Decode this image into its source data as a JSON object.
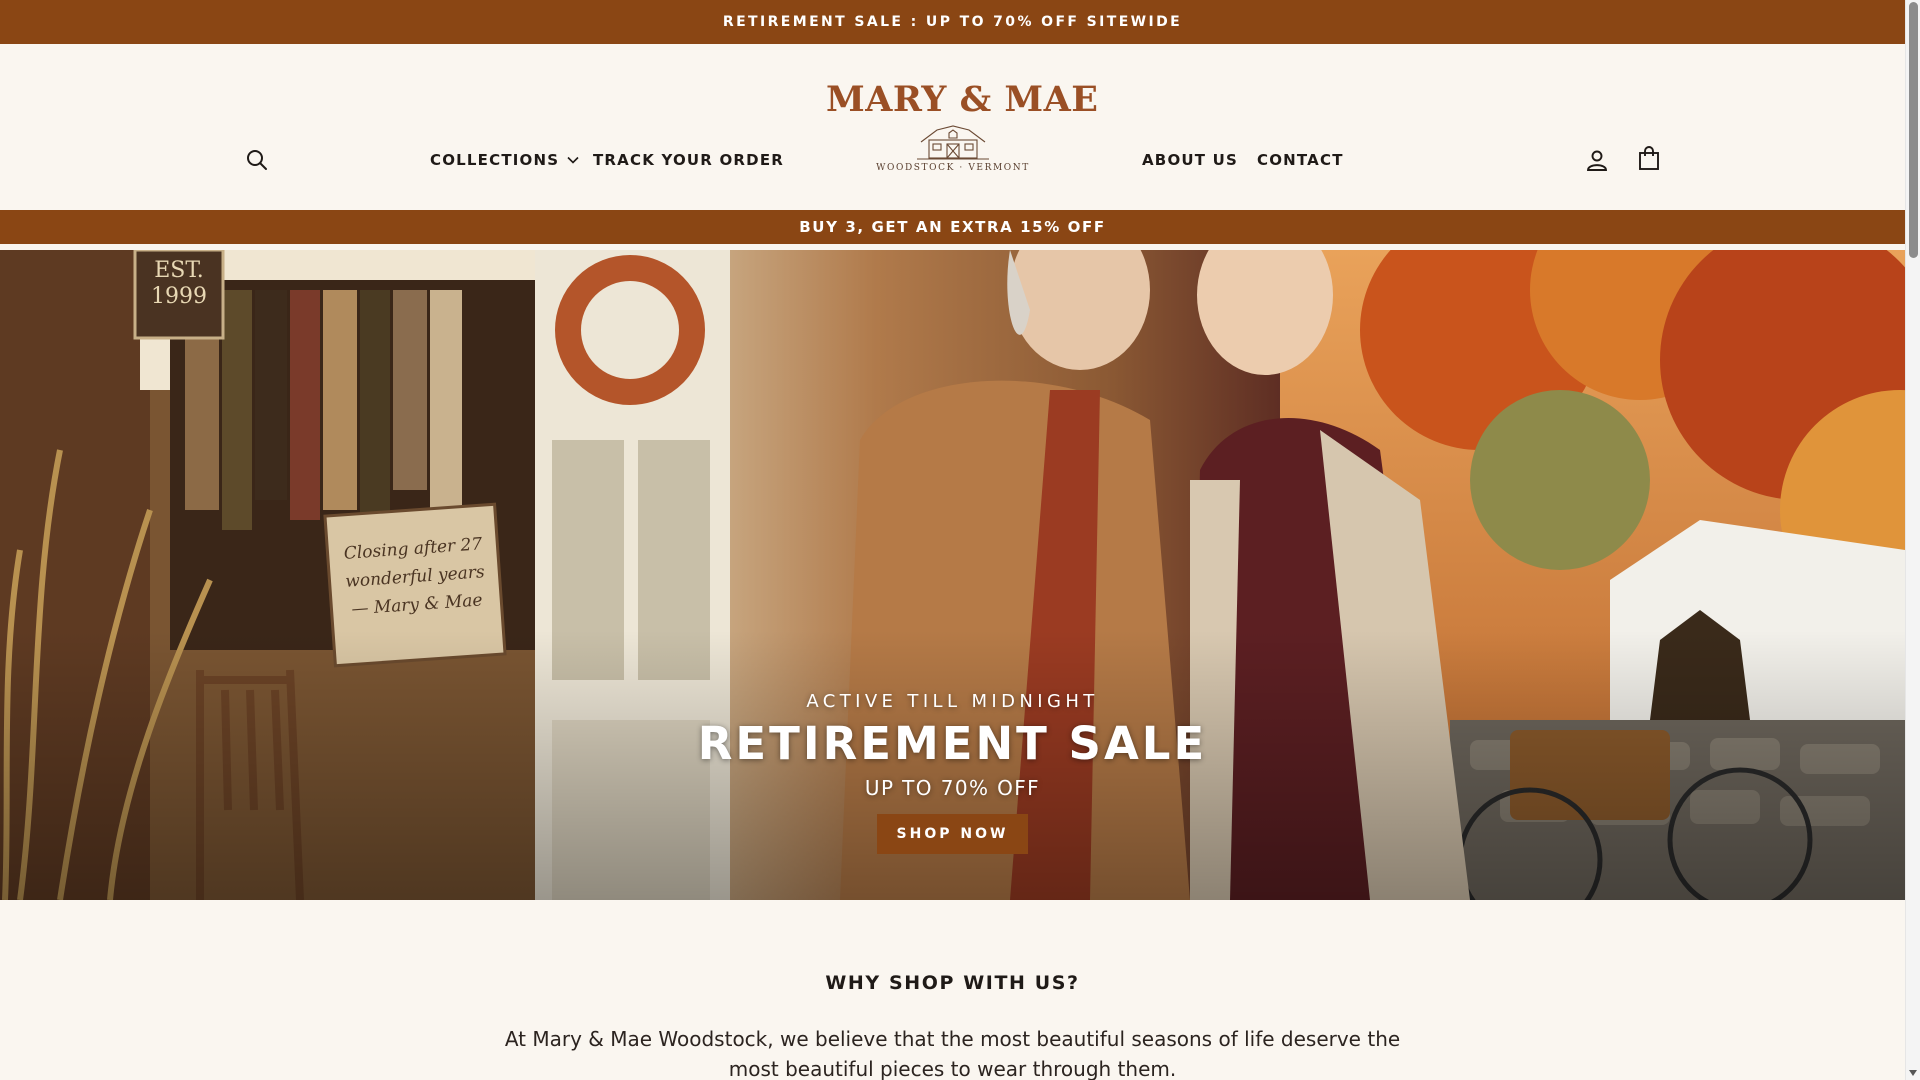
{
  "announcement_bar": {
    "text": "RETIREMENT SALE : UP TO 70% OFF SITEWIDE"
  },
  "header": {
    "search_icon": "search-icon",
    "nav_left": [
      {
        "label": "COLLECTIONS",
        "has_dropdown": true
      },
      {
        "label": "TRACK YOUR ORDER"
      }
    ],
    "logo": {
      "name": "MARY & MAE",
      "tagline": "WOODSTOCK · VERMONT"
    },
    "nav_right": [
      {
        "label": "ABOUT US"
      },
      {
        "label": "CONTACT"
      }
    ],
    "account_icon": "account-icon",
    "cart_icon": "cart-icon"
  },
  "promo_bar": {
    "text": "BUY 3, GET AN EXTRA 15% OFF"
  },
  "hero": {
    "eyebrow": "ACTIVE TILL MIDNIGHT",
    "title": "RETIREMENT SALE",
    "subtitle": "UP TO 70% OFF",
    "button_label": "SHOP NOW",
    "image_text": {
      "plaque": "EST. 1999",
      "sign": "Closing after 27 wonderful years — Mary & Mae"
    }
  },
  "why_section": {
    "title": "WHY SHOP WITH US?",
    "body": "At Mary & Mae Woodstock, we believe that the most beautiful seasons of life deserve the most beautiful pieces to wear through them."
  },
  "colors": {
    "brand_brown": "#8a4614",
    "logo_brown": "#9a4f25",
    "page_background": "#faf6f0",
    "text_dark": "#1f1a17"
  }
}
